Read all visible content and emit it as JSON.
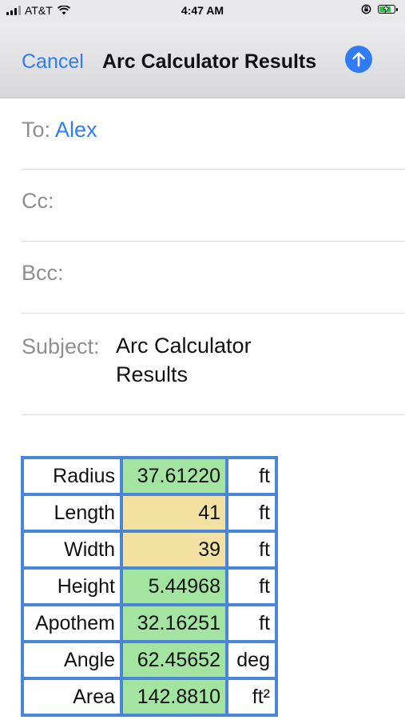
{
  "status_bar": {
    "carrier": "AT&T",
    "time": "4:47 AM",
    "battery_level": 0.85,
    "icons": [
      "signal-icon",
      "wifi-icon",
      "orientation-lock-icon",
      "battery-charging-icon"
    ]
  },
  "nav": {
    "cancel_label": "Cancel",
    "title": "Arc Calculator Results",
    "send_icon": "arrow-up-icon"
  },
  "compose": {
    "to_label": "To:",
    "to_recipient": "Alex",
    "cc_label": "Cc:",
    "bcc_label": "Bcc:",
    "subject_label": "Subject:",
    "subject_value": "Arc Calculator Results"
  },
  "colors": {
    "accent": "#2f7cf6",
    "table_border": "#4a86d8",
    "computed_fill": "#a3e5a0",
    "input_fill": "#f2e1a1"
  },
  "results": [
    {
      "label": "Radius",
      "value": "37.61220",
      "unit": "ft",
      "kind": "computed"
    },
    {
      "label": "Length",
      "value": "41",
      "unit": "ft",
      "kind": "input"
    },
    {
      "label": "Width",
      "value": "39",
      "unit": "ft",
      "kind": "input"
    },
    {
      "label": "Height",
      "value": "5.44968",
      "unit": "ft",
      "kind": "computed"
    },
    {
      "label": "Apothem",
      "value": "32.16251",
      "unit": "ft",
      "kind": "computed"
    },
    {
      "label": "Angle",
      "value": "62.45652",
      "unit": "deg",
      "kind": "computed"
    },
    {
      "label": "Area",
      "value": "142.8810",
      "unit": "ft²",
      "kind": "computed"
    }
  ]
}
